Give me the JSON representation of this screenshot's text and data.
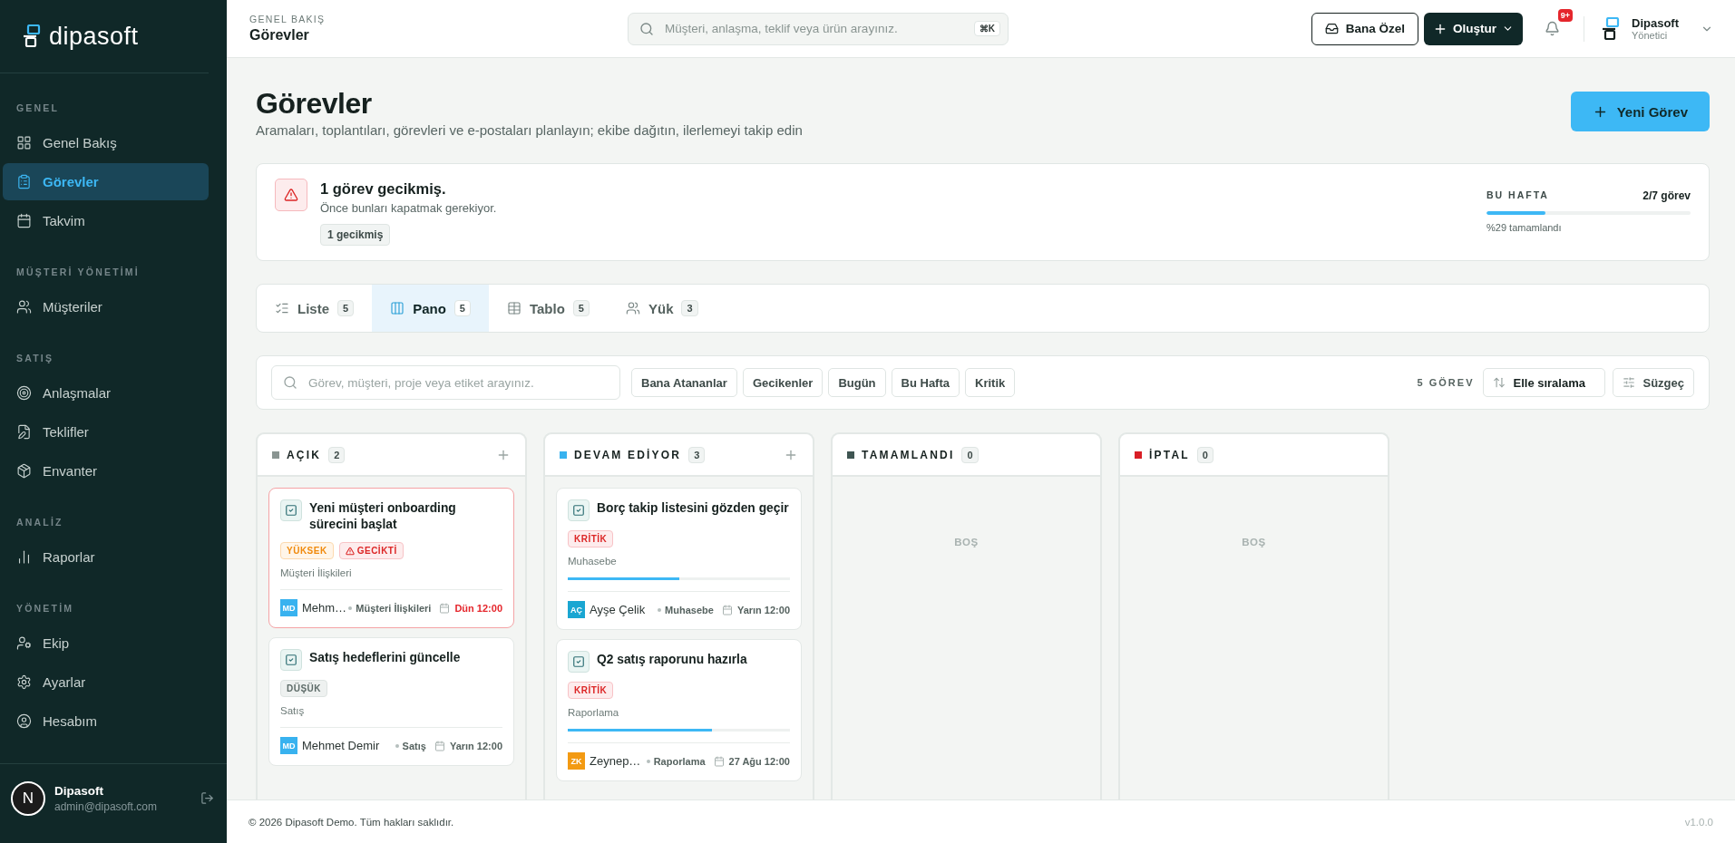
{
  "sidebar": {
    "logo": "dipasoft",
    "sections": [
      {
        "title": "GENEL",
        "items": [
          {
            "label": "Genel Bakış",
            "selected": false
          },
          {
            "label": "Görevler",
            "selected": true
          },
          {
            "label": "Takvim",
            "selected": false
          }
        ]
      },
      {
        "title": "MÜŞTERİ YÖNETİMİ",
        "items": [
          {
            "label": "Müşteriler",
            "selected": false
          }
        ]
      },
      {
        "title": "SATIŞ",
        "items": [
          {
            "label": "Anlaşmalar",
            "selected": false
          },
          {
            "label": "Teklifler",
            "selected": false
          },
          {
            "label": "Envanter",
            "selected": false
          }
        ]
      },
      {
        "title": "ANALİZ",
        "items": [
          {
            "label": "Raporlar",
            "selected": false
          }
        ]
      },
      {
        "title": "YÖNETİM",
        "items": [
          {
            "label": "Ekip",
            "selected": false
          },
          {
            "label": "Ayarlar",
            "selected": false
          },
          {
            "label": "Hesabım",
            "selected": false
          }
        ]
      }
    ],
    "user": {
      "avatar_letter": "N",
      "name": "Dipasoft",
      "email": "admin@dipasoft.com"
    }
  },
  "header": {
    "breadcrumb": "GENEL BAKIŞ",
    "title": "Görevler",
    "search_placeholder": "Müşteri, anlaşma, teklif veya ürün arayınız.",
    "shortcut": "⌘K",
    "personal_button": "Bana Özel",
    "create_button": "Oluştur",
    "notification_badge": "9+",
    "account_name": "Dipasoft",
    "account_role": "Yönetici"
  },
  "page": {
    "title": "Görevler",
    "subtitle": "Aramaları, toplantıları, görevleri ve e-postaları planlayın; ekibe dağıtın, ilerlemeyi takip edin",
    "new_button": "Yeni Görev"
  },
  "alert": {
    "title": "1 görev gecikmiş.",
    "text": "Önce bunları kapatmak gerekiyor.",
    "chip": "1 gecikmiş"
  },
  "week": {
    "label": "BU HAFTA",
    "count": "2/7 görev",
    "level": 0.29,
    "caption": "%29 tamamlandı"
  },
  "tabs": [
    {
      "label": "Liste",
      "count": "5",
      "selected": false
    },
    {
      "label": "Pano",
      "count": "5",
      "selected": true
    },
    {
      "label": "Tablo",
      "count": "5",
      "selected": false
    },
    {
      "label": "Yük",
      "count": "3",
      "selected": false
    }
  ],
  "filters": {
    "search_placeholder": "Görev, müşteri, proje veya etiket arayınız.",
    "chips": [
      "Bana Atananlar",
      "Gecikenler",
      "Bugün",
      "Bu Hafta",
      "Kritik"
    ],
    "count": "5 GÖREV",
    "sort": "Elle sıralama",
    "filter_button": "Süzgeç"
  },
  "columns": [
    {
      "title": "AÇIK",
      "count": "2",
      "color": "#8a9592",
      "addable": true,
      "cards": [
        {
          "title": "Yeni müşteri onboarding sürecini başlat",
          "overdue": true,
          "tags": [
            {
              "label": "YÜKSEK",
              "kind": "high"
            },
            {
              "label": "GECİKTİ",
              "kind": "late"
            }
          ],
          "category": "Müşteri İlişkileri",
          "initials": "MD",
          "color": "#38b2ef",
          "assignee": "Mehm…",
          "dept": "Müşteri İlişkileri",
          "due": "Dün 12:00"
        },
        {
          "title": "Satış hedeflerini güncelle",
          "overdue": false,
          "tags": [
            {
              "label": "DÜŞÜK",
              "kind": "low"
            }
          ],
          "category": "Satış",
          "initials": "MD",
          "color": "#38b2ef",
          "assignee": "Mehmet Demir",
          "dept": "Satış",
          "due": "Yarın 12:00"
        }
      ]
    },
    {
      "title": "DEVAM EDİYOR",
      "count": "3",
      "color": "#38b2ef",
      "addable": true,
      "cards": [
        {
          "title": "Borç takip listesini gözden geçir",
          "overdue": false,
          "tags": [
            {
              "label": "KRİTİK",
              "kind": "critical"
            }
          ],
          "category": "Muhasebe",
          "level": 0.5,
          "initials": "AÇ",
          "color": "#1aa6d2",
          "assignee": "Ayşe Çelik",
          "dept": "Muhasebe",
          "due": "Yarın 12:00"
        },
        {
          "title": "Q2 satış raporunu hazırla",
          "overdue": false,
          "tags": [
            {
              "label": "KRİTİK",
              "kind": "critical"
            }
          ],
          "category": "Raporlama",
          "level": 0.65,
          "initials": "ZK",
          "color": "#f39a12",
          "assignee": "Zeynep…",
          "dept": "Raporlama",
          "due": "27 Ağu 12:00"
        }
      ]
    },
    {
      "title": "TAMAMLANDI",
      "count": "0",
      "color": "#3f5552",
      "addable": false,
      "empty": "BOŞ"
    },
    {
      "title": "İPTAL",
      "count": "0",
      "color": "#d91f26",
      "addable": false,
      "empty": "BOŞ"
    }
  ],
  "footer": {
    "copyright": "© 2026 Dipasoft Demo. Tüm hakları saklıdır.",
    "version": "v1.0.0"
  }
}
